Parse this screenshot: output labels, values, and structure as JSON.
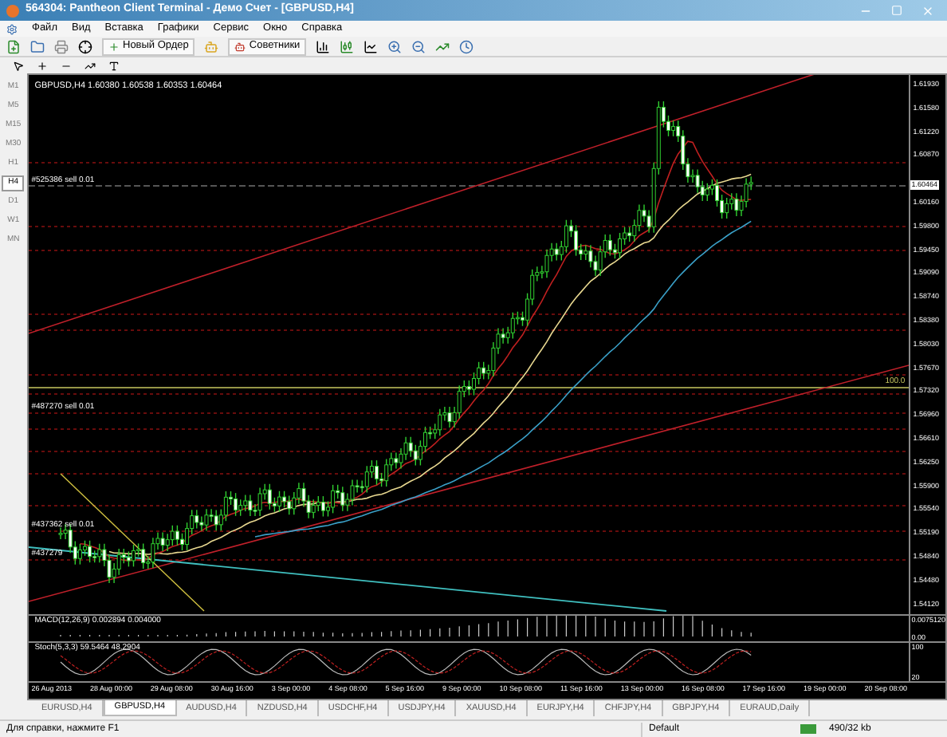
{
  "window": {
    "title": "564304: Pantheon Client Terminal - Демо Счет - [GBPUSD,H4]"
  },
  "menu": [
    "Файл",
    "Вид",
    "Вставка",
    "Графики",
    "Сервис",
    "Окно",
    "Справка"
  ],
  "toolbar": {
    "new_order": "Новый Ордер",
    "experts": "Советники"
  },
  "timeframes": [
    {
      "label": "M1",
      "selected": false
    },
    {
      "label": "M5",
      "selected": false
    },
    {
      "label": "M15",
      "selected": false
    },
    {
      "label": "M30",
      "selected": false
    },
    {
      "label": "H1",
      "selected": false
    },
    {
      "label": "H4",
      "selected": true
    },
    {
      "label": "D1",
      "selected": false
    },
    {
      "label": "W1",
      "selected": false
    },
    {
      "label": "MN",
      "selected": false
    }
  ],
  "chart": {
    "header": "GBPUSD,H4 1.60380 1.60538 1.60353 1.60464",
    "orders": [
      "#525386 sell 0.01",
      "#487270 sell 0.01",
      "#437362 sell 0.01",
      "#437279"
    ],
    "fib_label": "100.0",
    "current_price": "1.60464",
    "price_axis": [
      "1.61930",
      "1.61580",
      "1.61220",
      "1.60870",
      "1.60160",
      "1.59800",
      "1.59450",
      "1.59090",
      "1.58740",
      "1.58380",
      "1.58030",
      "1.57670",
      "1.57320",
      "1.56960",
      "1.56610",
      "1.56250",
      "1.55900",
      "1.55540",
      "1.55190",
      "1.54840",
      "1.54480",
      "1.54120"
    ],
    "macd": {
      "label": "MACD(12,26,9) 0.002894 0.004000",
      "axis": [
        "0.0075120",
        "0.00"
      ]
    },
    "stoch": {
      "label": "Stoch(5,3,3) 59.5464 48.2904",
      "axis": [
        "100",
        "20"
      ]
    },
    "time_axis": [
      "26 Aug 2013",
      "28 Aug 00:00",
      "29 Aug 08:00",
      "30 Aug 16:00",
      "3 Sep 00:00",
      "4 Sep 08:00",
      "5 Sep 16:00",
      "9 Sep 00:00",
      "10 Sep 08:00",
      "11 Sep 16:00",
      "13 Sep 00:00",
      "16 Sep 08:00",
      "17 Sep 16:00",
      "19 Sep 00:00",
      "20 Sep 08:00"
    ]
  },
  "tabs": [
    {
      "label": "EURUSD,H4",
      "selected": false
    },
    {
      "label": "GBPUSD,H4",
      "selected": true
    },
    {
      "label": "AUDUSD,H4",
      "selected": false
    },
    {
      "label": "NZDUSD,H4",
      "selected": false
    },
    {
      "label": "USDCHF,H4",
      "selected": false
    },
    {
      "label": "USDJPY,H4",
      "selected": false
    },
    {
      "label": "XAUUSD,H4",
      "selected": false
    },
    {
      "label": "EURJPY,H4",
      "selected": false
    },
    {
      "label": "CHFJPY,H4",
      "selected": false
    },
    {
      "label": "GBPJPY,H4",
      "selected": false
    },
    {
      "label": "EURAUD,Daily",
      "selected": false
    }
  ],
  "status_bar": {
    "help": "Для справки, нажмите F1",
    "profile": "Default",
    "traffic": "490/32 kb"
  }
}
